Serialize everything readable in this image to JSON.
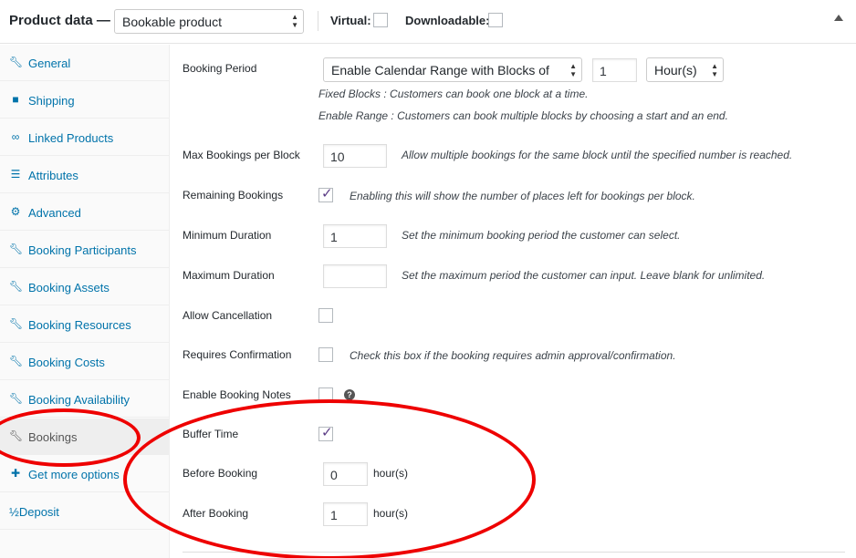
{
  "header": {
    "title": "Product data —",
    "product_type": "Bookable product",
    "virtual_label": "Virtual:",
    "downloadable_label": "Downloadable:"
  },
  "sidebar": {
    "items": [
      {
        "label": "General",
        "icon": "wrench-icon"
      },
      {
        "label": "Shipping",
        "icon": "truck-icon"
      },
      {
        "label": "Linked Products",
        "icon": "link-icon"
      },
      {
        "label": "Attributes",
        "icon": "list-icon"
      },
      {
        "label": "Advanced",
        "icon": "gear-icon"
      },
      {
        "label": "Booking Participants",
        "icon": "wrench-icon"
      },
      {
        "label": "Booking Assets",
        "icon": "wrench-icon"
      },
      {
        "label": "Booking Resources",
        "icon": "wrench-icon"
      },
      {
        "label": "Booking Costs",
        "icon": "wrench-icon"
      },
      {
        "label": "Booking Availability",
        "icon": "wrench-icon"
      },
      {
        "label": "Bookings",
        "icon": "wrench-icon",
        "active": true
      },
      {
        "label": "Get more options",
        "icon": "plus-icon"
      },
      {
        "label": "½Deposit",
        "icon": ""
      }
    ]
  },
  "form": {
    "booking_period": {
      "label": "Booking Period",
      "type_value": "Enable Calendar Range with Blocks of",
      "block_value": "1",
      "unit_value": "Hour(s)",
      "desc_fixed": "Fixed Blocks : Customers can book one block at a time.",
      "desc_range": "Enable Range : Customers can book multiple blocks by choosing a start and an end."
    },
    "max_bookings": {
      "label": "Max Bookings per Block",
      "value": "10",
      "desc": "Allow multiple bookings for the same block until the specified number is reached."
    },
    "remaining_bookings": {
      "label": "Remaining Bookings",
      "checked": true,
      "desc": "Enabling this will show the number of places left for bookings per block."
    },
    "min_duration": {
      "label": "Minimum Duration",
      "value": "1",
      "desc": "Set the minimum booking period the customer can select."
    },
    "max_duration": {
      "label": "Maximum Duration",
      "value": "",
      "desc": "Set the maximum period the customer can input. Leave blank for unlimited."
    },
    "allow_cancellation": {
      "label": "Allow Cancellation",
      "checked": false
    },
    "requires_confirmation": {
      "label": "Requires Confirmation",
      "checked": false,
      "desc": "Check this box if the booking requires admin approval/confirmation."
    },
    "booking_notes": {
      "label": "Enable Booking Notes",
      "checked": false,
      "help": "?"
    },
    "buffer_time": {
      "label": "Buffer Time",
      "checked": true
    },
    "before_booking": {
      "label": "Before Booking",
      "value": "0",
      "unit": "hour(s)"
    },
    "after_booking": {
      "label": "After Booking",
      "value": "1",
      "unit": "hour(s)"
    }
  },
  "colors": {
    "link": "#0073aa",
    "annotation": "#e00000",
    "check": "#5b3c86"
  }
}
